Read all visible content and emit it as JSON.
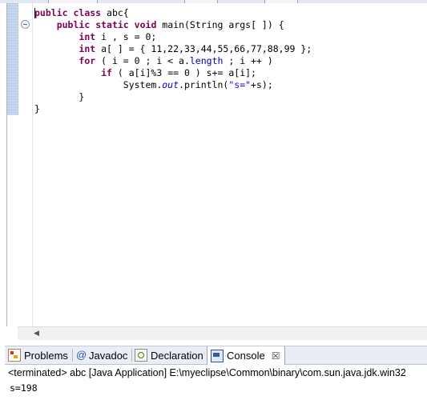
{
  "editor": {
    "code_lines": [
      [
        {
          "t": "public",
          "c": "kw"
        },
        {
          "t": " "
        },
        {
          "t": "class",
          "c": "kw"
        },
        {
          "t": " abc{"
        }
      ],
      [
        {
          "t": "    "
        },
        {
          "t": "public",
          "c": "kw"
        },
        {
          "t": " "
        },
        {
          "t": "static",
          "c": "kw"
        },
        {
          "t": " "
        },
        {
          "t": "void",
          "c": "kw"
        },
        {
          "t": " main(String args[ ]) {"
        }
      ],
      [
        {
          "t": "        "
        },
        {
          "t": "int",
          "c": "kw"
        },
        {
          "t": " i , s = 0;"
        }
      ],
      [
        {
          "t": "        "
        },
        {
          "t": "int",
          "c": "kw"
        },
        {
          "t": " a[ ] = { 11,22,33,44,55,66,77,88,99 };"
        }
      ],
      [
        {
          "t": "        "
        },
        {
          "t": "for",
          "c": "kw"
        },
        {
          "t": " ( i = 0 ; i < a."
        },
        {
          "t": "length",
          "c": "field"
        },
        {
          "t": " ; i ++ )"
        }
      ],
      [
        {
          "t": "            "
        },
        {
          "t": "if",
          "c": "kw"
        },
        {
          "t": " ( a[i]%3 == 0 ) s+= a[i];"
        }
      ],
      [
        {
          "t": "                System."
        },
        {
          "t": "out",
          "c": "stat"
        },
        {
          "t": ".println("
        },
        {
          "t": "\"s=\"",
          "c": "str"
        },
        {
          "t": "+s);"
        }
      ],
      [
        {
          "t": "        }"
        }
      ],
      [
        {
          "t": "}"
        }
      ]
    ]
  },
  "bottom_panel": {
    "tabs": {
      "problems": "Problems",
      "javadoc_symbol": "@",
      "javadoc": "Javadoc",
      "declaration": "Declaration",
      "console": "Console",
      "close_symbol": "☒"
    },
    "console": {
      "status": "<terminated> abc [Java Application] E:\\myeclipse\\Common\\binary\\com.sun.java.jdk.win32",
      "output": "s=198"
    }
  }
}
